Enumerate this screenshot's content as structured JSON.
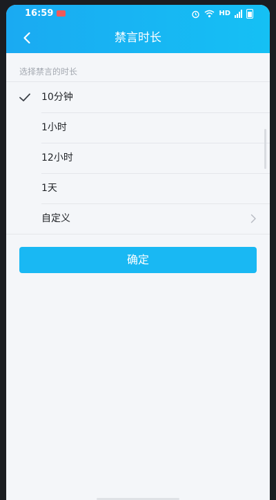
{
  "status_bar": {
    "time": "16:59",
    "network": "HD"
  },
  "nav": {
    "title": "禁言时长",
    "back_icon": "chevron-left-icon"
  },
  "section": {
    "label": "选择禁言的时长"
  },
  "options": [
    {
      "label": "10分钟",
      "selected": true
    },
    {
      "label": "1小时",
      "selected": false
    },
    {
      "label": "12小时",
      "selected": false
    },
    {
      "label": "1天",
      "selected": false
    },
    {
      "label": "自定义",
      "selected": false,
      "has_chevron": true
    }
  ],
  "confirm": {
    "label": "确定"
  },
  "colors": {
    "accent": "#19b8f3",
    "header_start": "#1aaaf2",
    "header_end": "#15c0f4",
    "background": "#f4f6f9"
  }
}
